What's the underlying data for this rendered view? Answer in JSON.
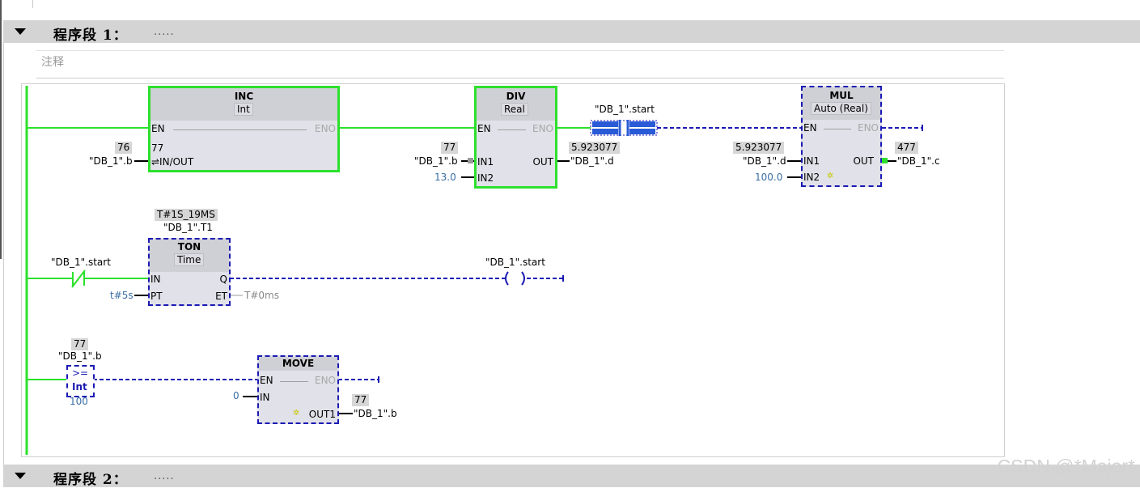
{
  "segments": [
    {
      "title": "程序段 1：",
      "dots": "....."
    },
    {
      "title": "程序段 2：",
      "dots": "....."
    }
  ],
  "comment_placeholder": "注释",
  "rung1": {
    "inc": {
      "name": "INC",
      "type": "Int",
      "en": "EN",
      "eno": "ENO",
      "inout_pin": "⇌IN/OUT",
      "inout_before": "76",
      "inout_after": "77",
      "inout_var": "\"DB_1\".b"
    },
    "div": {
      "name": "DIV",
      "type": "Real",
      "en": "EN",
      "eno": "ENO",
      "in1": "IN1",
      "in2": "IN2",
      "out": "OUT",
      "in1_value": "77",
      "in1_var": "\"DB_1\".b",
      "in2_value": "13.0",
      "out_value": "5.923077",
      "out_var": "\"DB_1\".d"
    },
    "contact": {
      "var": "\"DB_1\".start"
    },
    "mul": {
      "name": "MUL",
      "type": "Auto (Real)",
      "en": "EN",
      "eno": "ENO",
      "in1": "IN1",
      "in2": "IN2",
      "out": "OUT",
      "in1_value": "5.923077",
      "in1_var": "\"DB_1\".d",
      "in2_value": "100.0",
      "out_value": "477",
      "out_var": "\"DB_1\".c"
    }
  },
  "rung2": {
    "contact": {
      "var": "\"DB_1\".start"
    },
    "ton": {
      "name": "TON",
      "type": "Time",
      "instance_value": "T#1S_19MS",
      "instance_var": "\"DB_1\".T1",
      "in": "IN",
      "pt": "PT",
      "q": "Q",
      "et": "ET",
      "pt_value": "t#5s",
      "et_value": "T#0ms"
    },
    "coil": {
      "var": "\"DB_1\".start"
    }
  },
  "rung3": {
    "compare": {
      "op": ">=",
      "type": "Int",
      "in1_value": "77",
      "in1_var": "\"DB_1\".b",
      "in2_value": "100"
    },
    "move": {
      "name": "MOVE",
      "en": "EN",
      "eno": "ENO",
      "in": "IN",
      "out1": "OUT1",
      "in_value": "0",
      "out_value": "77",
      "out_var": "\"DB_1\".b"
    }
  },
  "watermark": "CSDN @*Major*",
  "colors": {
    "energized": "#2de02d",
    "unpowered": "#1a1ab4",
    "header_bg": "#d4d4d4",
    "value_bg": "#d6d6d6"
  }
}
